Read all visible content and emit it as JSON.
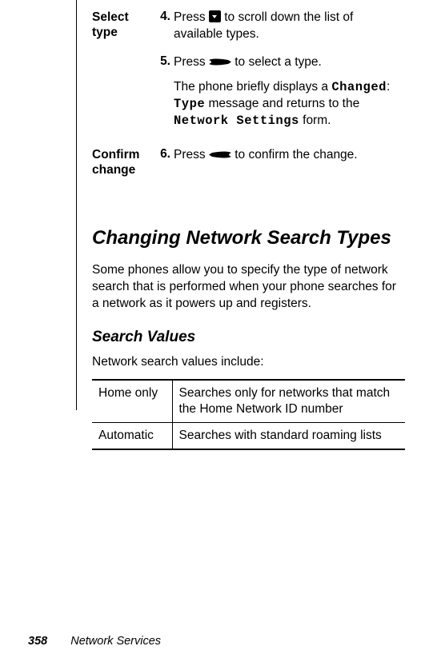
{
  "steps": {
    "selectType": {
      "label": "Select type",
      "s4": {
        "num": "4.",
        "pre": "Press ",
        "post": " to scroll down the list of available types."
      },
      "s5": {
        "num": "5.",
        "pre": "Press ",
        "post": " to select a type."
      },
      "s5note": {
        "pre": "The phone briefly displays a ",
        "lcd1": "Changed",
        "colon": ": ",
        "lcd2": "Type",
        "mid": " message and returns to the ",
        "lcd3": "Network Settings",
        "post": " form."
      }
    },
    "confirm": {
      "label": "Confirm change",
      "s6": {
        "num": "6.",
        "pre": "Press ",
        "post": " to confirm the change."
      }
    }
  },
  "section": {
    "title": "Changing Network Search Types",
    "para": "Some phones allow you to specify the type of network search that is performed when your phone searches for a network as it powers up and registers."
  },
  "subsection": {
    "title": "Search Values",
    "intro": "Network search values include:"
  },
  "table": {
    "rows": [
      {
        "name": "Home only",
        "desc": "Searches only for networks that match the Home Network ID number"
      },
      {
        "name": "Automatic",
        "desc": "Searches with standard roaming lists"
      }
    ]
  },
  "footer": {
    "page": "358",
    "name": "Network Services"
  }
}
